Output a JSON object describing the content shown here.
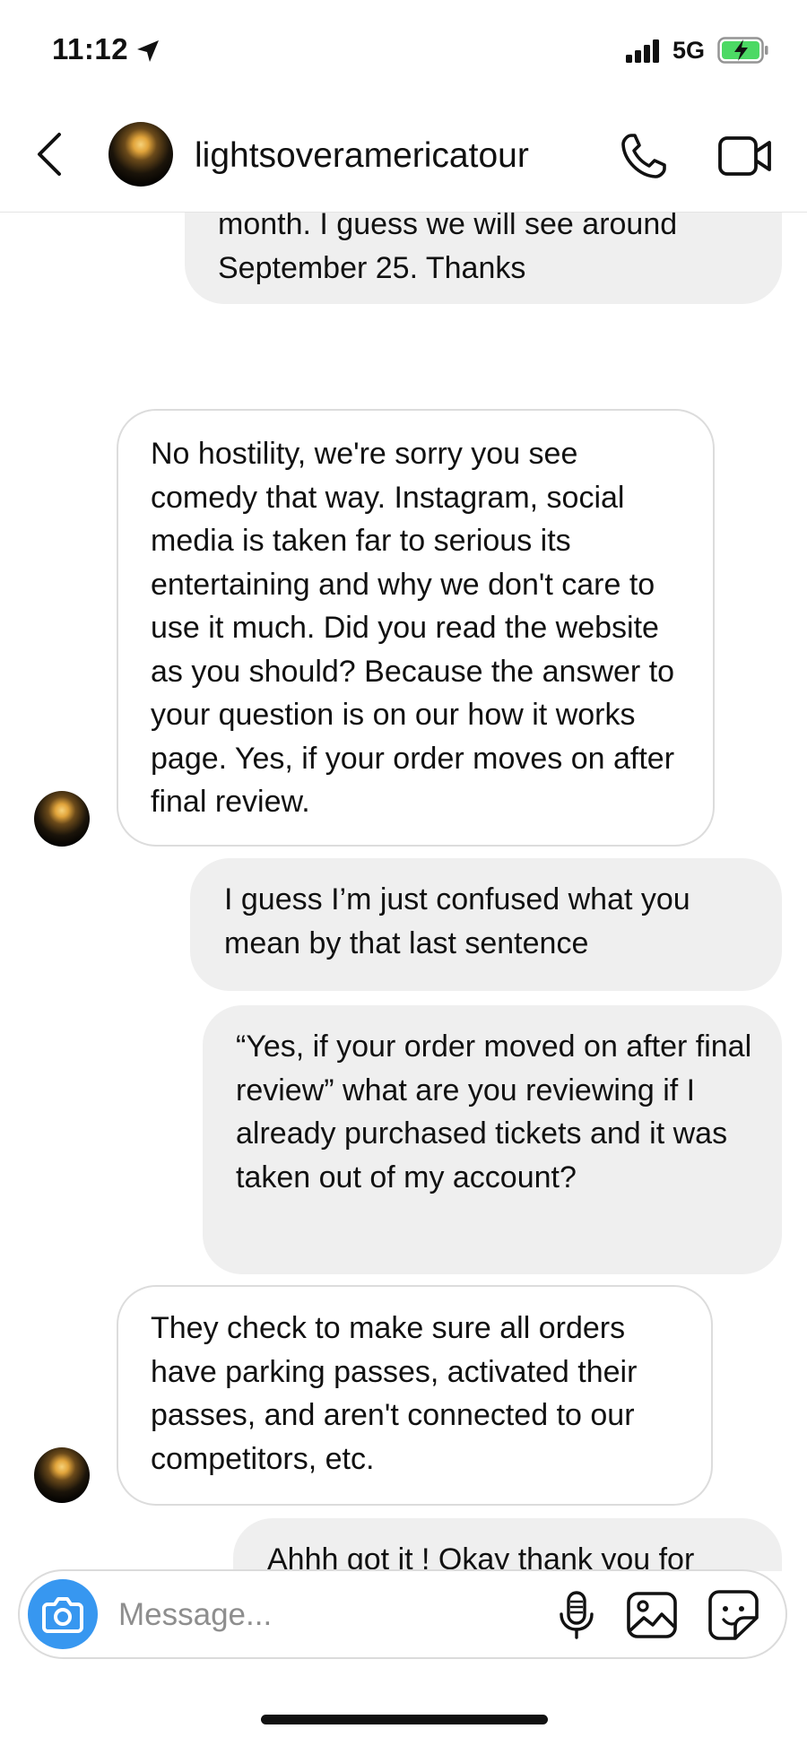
{
  "status_bar": {
    "time": "11:12",
    "network": "5G"
  },
  "header": {
    "username": "lightsoveramericatour"
  },
  "messages": [
    {
      "text": "have yet received any information still when the festival is supposed to be this month. I guess we will see around September 25. Thanks"
    },
    {
      "text": "No hostility, we're sorry you see comedy that way. Instagram, social media is taken far to serious its entertaining and why we don't care to use it much. Did you read the website as you should? Because the answer to your question is on our how it works page. Yes, if your order moves on after final review."
    },
    {
      "text": "I guess I’m just confused what you mean by that last sentence"
    },
    {
      "text": "“Yes, if your order moved on after final review” what are you reviewing if I already purchased tickets and it was taken out of my account?"
    },
    {
      "text": "They check to make sure all orders have parking passes, activated their passes, and aren't connected to our competitors, etc."
    },
    {
      "text": "Ahhh got it ! Okay thank you for"
    }
  ],
  "composer": {
    "placeholder": "Message..."
  },
  "colors": {
    "accent": "#3797f0",
    "outgoing_bubble": "#efefef",
    "incoming_border": "#dcdcdc",
    "battery_charging": "#4cd964"
  }
}
